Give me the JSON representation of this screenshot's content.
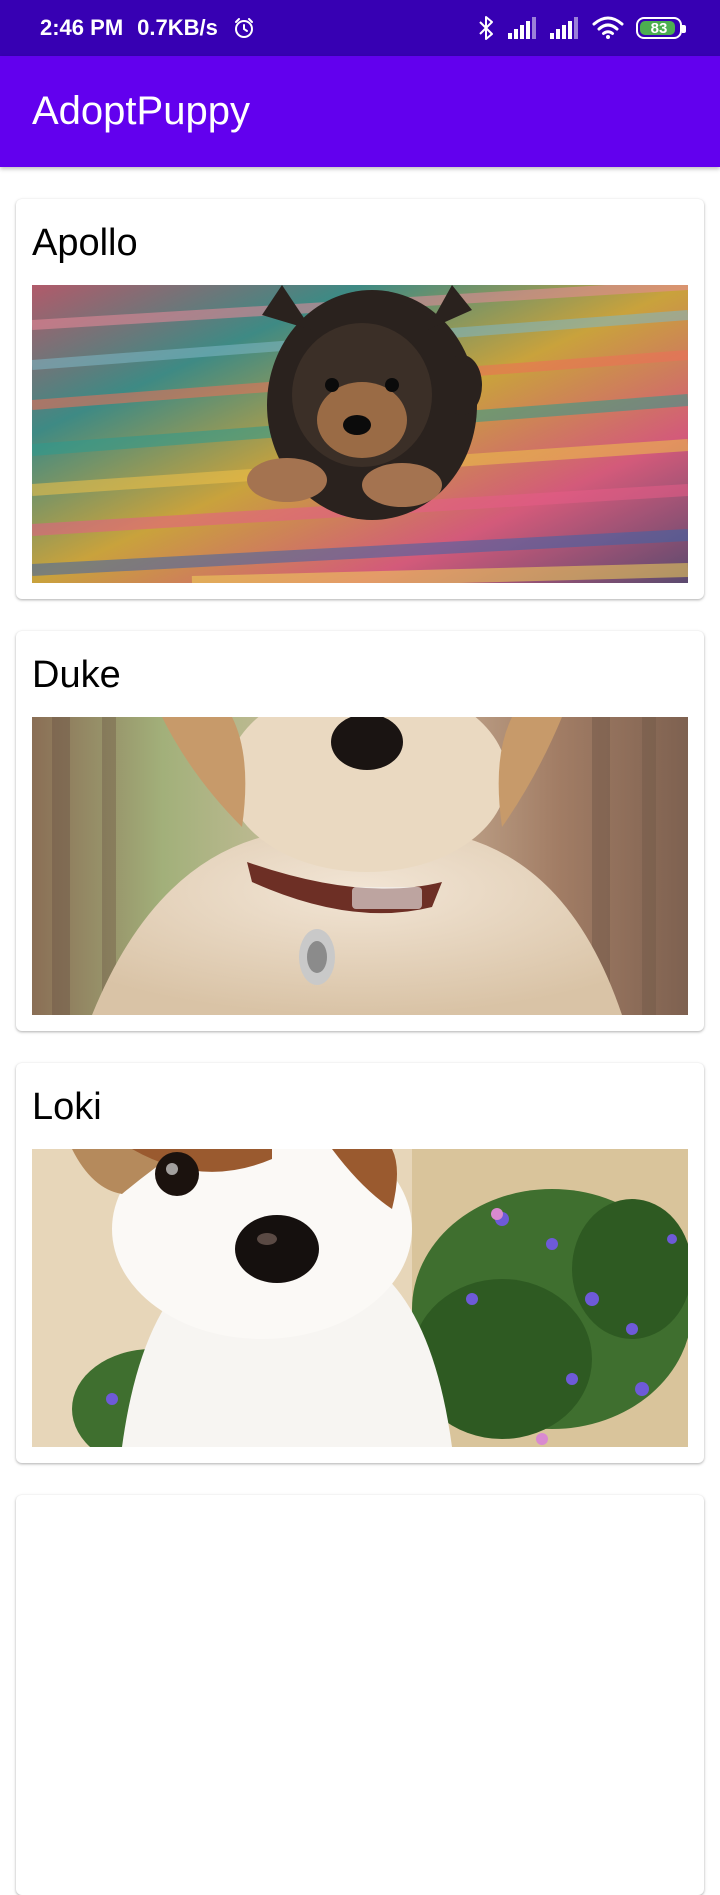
{
  "status_bar": {
    "time": "2:46 PM",
    "speed": "0.7KB/s",
    "battery": "83",
    "icons": [
      "alarm-icon",
      "bluetooth-icon",
      "signal-icon",
      "signal-icon",
      "wifi-icon",
      "battery-icon"
    ]
  },
  "app_bar": {
    "title": "AdoptPuppy",
    "color": "#6200ee",
    "status_color": "#3700b3"
  },
  "puppies": [
    {
      "name": "Apollo"
    },
    {
      "name": "Duke"
    },
    {
      "name": "Loki"
    }
  ]
}
